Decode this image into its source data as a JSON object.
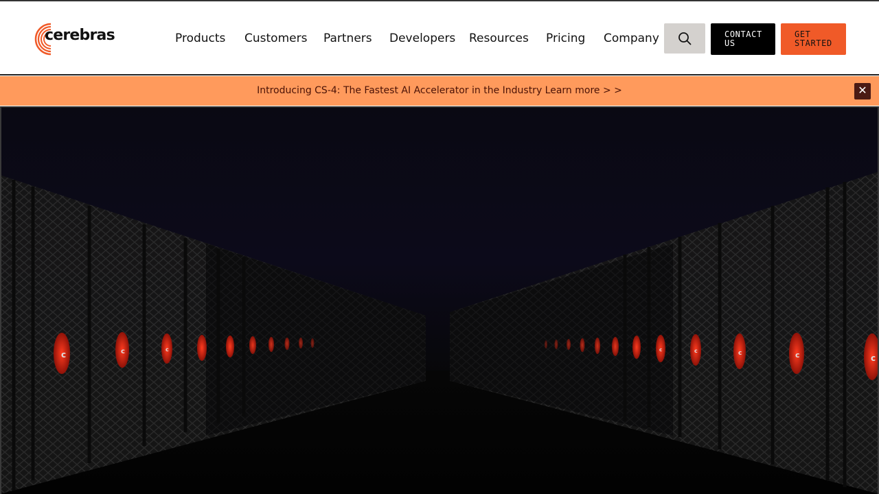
{
  "brand": {
    "name": "cerebras",
    "accent": "#f05a28"
  },
  "nav": {
    "items": [
      {
        "label": "Products"
      },
      {
        "label": "Customers"
      },
      {
        "label": "Partners"
      },
      {
        "label": "Developers"
      },
      {
        "label": "Resources"
      },
      {
        "label": "Pricing"
      },
      {
        "label": "Company"
      }
    ],
    "search_icon": "search-icon",
    "contact_label": "CONTACT US",
    "get_started_label": "GET STARTED"
  },
  "banner": {
    "text": "Introducing CS-4: The Fastest AI Accelerator in the Industry Learn more > >",
    "close_icon": "close-icon",
    "background": "#ff9a5c"
  },
  "hero": {
    "image": "data-center-server-aisle",
    "background": "#0a0913"
  }
}
